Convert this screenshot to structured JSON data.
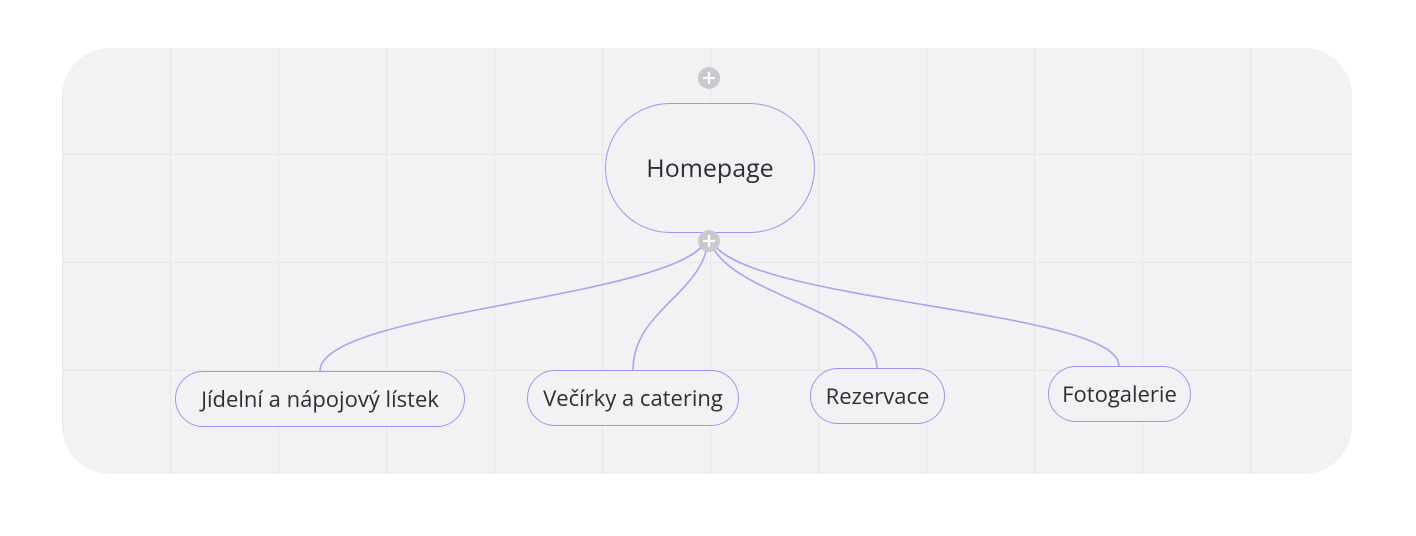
{
  "colors": {
    "canvas_bg": "#f2f2f4",
    "grid_line": "#e7e7ea",
    "node_border": "#9a98f2",
    "connector": "#a7a5f2",
    "text": "#2f2f33",
    "add_button_bg": "#c9c9ce",
    "add_button_plus": "#ffffff"
  },
  "root": {
    "label": "Homepage"
  },
  "children": [
    {
      "label": "Jídelní a nápojový lístek"
    },
    {
      "label": "Večírky a catering"
    },
    {
      "label": "Rezervace"
    },
    {
      "label": "Fotogalerie"
    }
  ],
  "add_buttons": {
    "above_root": "plus-icon",
    "below_root": "plus-icon"
  }
}
